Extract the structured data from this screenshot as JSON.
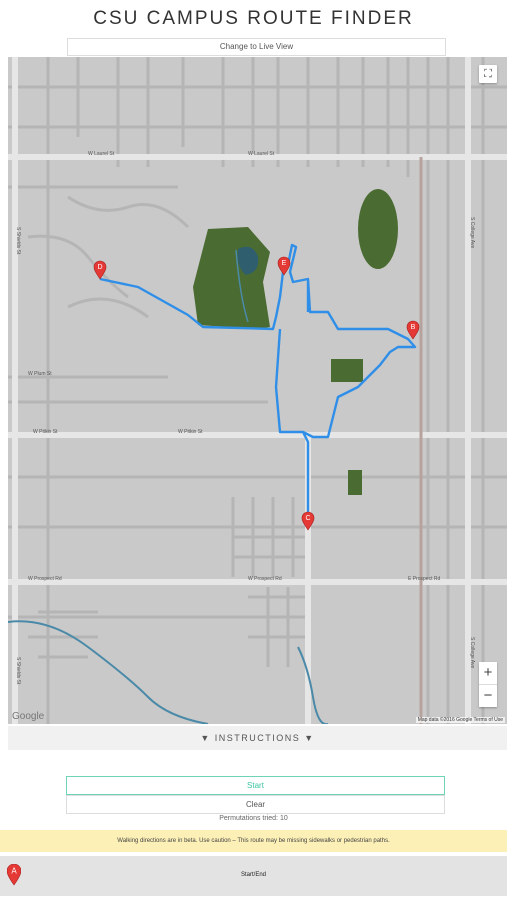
{
  "header": {
    "title": "CSU CAMPUS ROUTE FINDER"
  },
  "live_view_button": "Change to Live View",
  "map": {
    "markers": [
      {
        "label": "D"
      },
      {
        "label": "E"
      },
      {
        "label": "B"
      },
      {
        "label": "C"
      }
    ],
    "street_labels": {
      "laurel": "W Laurel St",
      "laurel2": "W Laurel St",
      "plum": "W Plum St",
      "pitkin": "W Pitkin St",
      "pitkin2": "W Pitkin St",
      "prospect": "W Prospect Rd",
      "prospect2": "W Prospect Rd",
      "prospect3": "E Prospect Rd",
      "college": "S College Ave",
      "college2": "S College Ave",
      "shields": "S Shields St",
      "shields2": "S Shields St"
    },
    "google_logo": "Google",
    "attribution": "Map data ©2016 Google   Terms of Use",
    "zoom_in": "+",
    "zoom_out": "−",
    "fullscreen_icon": "⛶",
    "colors": {
      "background": "#c9c9c9",
      "road": "#e4e4e4",
      "green": "#4a6b31",
      "route": "#2f8fe8",
      "marker": "#e53935",
      "water": "#4a8aa8",
      "rail": "#b7a39d"
    }
  },
  "instructions_toggle": "▼ INSTRUCTIONS ▼",
  "start_button": "Start",
  "clear_button": "Clear",
  "permutations": "Permutations tried: 10",
  "warning": "Walking directions are in beta. Use caution – This route may be missing sidewalks or pedestrian paths.",
  "start_end": {
    "marker": "A",
    "label": "Start/End"
  }
}
